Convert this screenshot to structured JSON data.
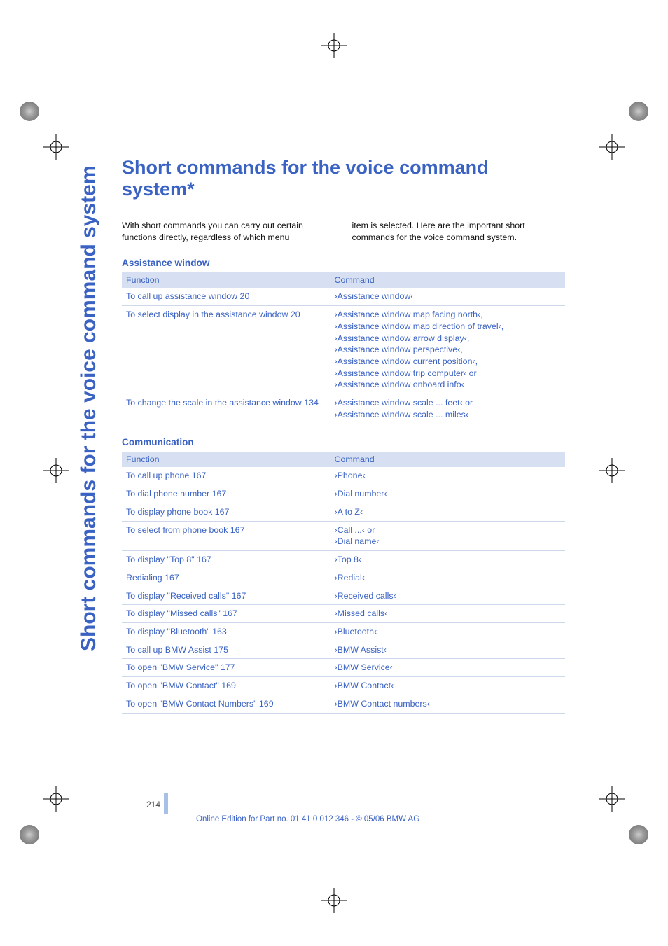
{
  "side_tab": "Short commands for the voice command system",
  "title": "Short commands for the voice command system*",
  "intro_left": "With short commands you can carry out certain functions directly, regardless of which menu",
  "intro_right": "item is selected. Here are the important short commands for the voice command system.",
  "table_headers": {
    "function": "Function",
    "command": "Command"
  },
  "section_assist": {
    "heading": "Assistance window",
    "rows": [
      {
        "func_text": "To call up assistance window",
        "page": "20",
        "cmd_lines": [
          "›Assistance window‹"
        ]
      },
      {
        "func_text": "To select display in the assistance window",
        "page": "20",
        "cmd_lines": [
          "›Assistance window map facing north‹,",
          "›Assistance window map direction of travel‹,",
          "›Assistance window arrow display‹,",
          "›Assistance window perspective‹,",
          "›Assistance window current position‹,",
          "›Assistance window trip computer‹ or",
          "›Assistance window onboard info‹"
        ]
      },
      {
        "func_text": "To change the scale in the assistance window",
        "page": "134",
        "cmd_lines": [
          "›Assistance window scale ... feet‹ or",
          "›Assistance window scale ... miles‹"
        ]
      }
    ]
  },
  "section_comm": {
    "heading": "Communication",
    "rows": [
      {
        "func_text": "To call up phone",
        "page": "167",
        "cmd_lines": [
          "›Phone‹"
        ]
      },
      {
        "func_text": "To dial phone number",
        "page": "167",
        "cmd_lines": [
          "›Dial number‹"
        ]
      },
      {
        "func_text": "To display phone book",
        "page": "167",
        "cmd_lines": [
          "›A to Z‹"
        ]
      },
      {
        "func_text": "To select from phone book",
        "page": "167",
        "cmd_lines": [
          "›Call ...‹ or",
          "›Dial name‹"
        ]
      },
      {
        "func_text": "To display \"Top 8\"",
        "page": "167",
        "cmd_lines": [
          "›Top 8‹"
        ]
      },
      {
        "func_text": "Redialing",
        "page": "167",
        "cmd_lines": [
          "›Redial‹"
        ]
      },
      {
        "func_text": "To display \"Received calls\"",
        "page": "167",
        "cmd_lines": [
          "›Received calls‹"
        ]
      },
      {
        "func_text": "To display \"Missed calls\"",
        "page": "167",
        "cmd_lines": [
          "›Missed calls‹"
        ]
      },
      {
        "func_text": "To display \"Bluetooth\"",
        "page": "163",
        "cmd_lines": [
          "›Bluetooth‹"
        ]
      },
      {
        "func_text": "To call up BMW Assist",
        "page": "175",
        "cmd_lines": [
          "›BMW Assist‹"
        ]
      },
      {
        "func_text": "To open \"BMW Service\"",
        "page": "177",
        "cmd_lines": [
          "›BMW Service‹"
        ]
      },
      {
        "func_text": "To open \"BMW Contact\"",
        "page": "169",
        "cmd_lines": [
          "›BMW Contact‹"
        ]
      },
      {
        "func_text": "To open \"BMW Contact Numbers\"",
        "page": "169",
        "cmd_lines": [
          "›BMW Contact numbers‹"
        ]
      }
    ]
  },
  "page_number": "214",
  "footer": "Online Edition for Part no. 01 41 0 012 346 - © 05/06 BMW AG"
}
